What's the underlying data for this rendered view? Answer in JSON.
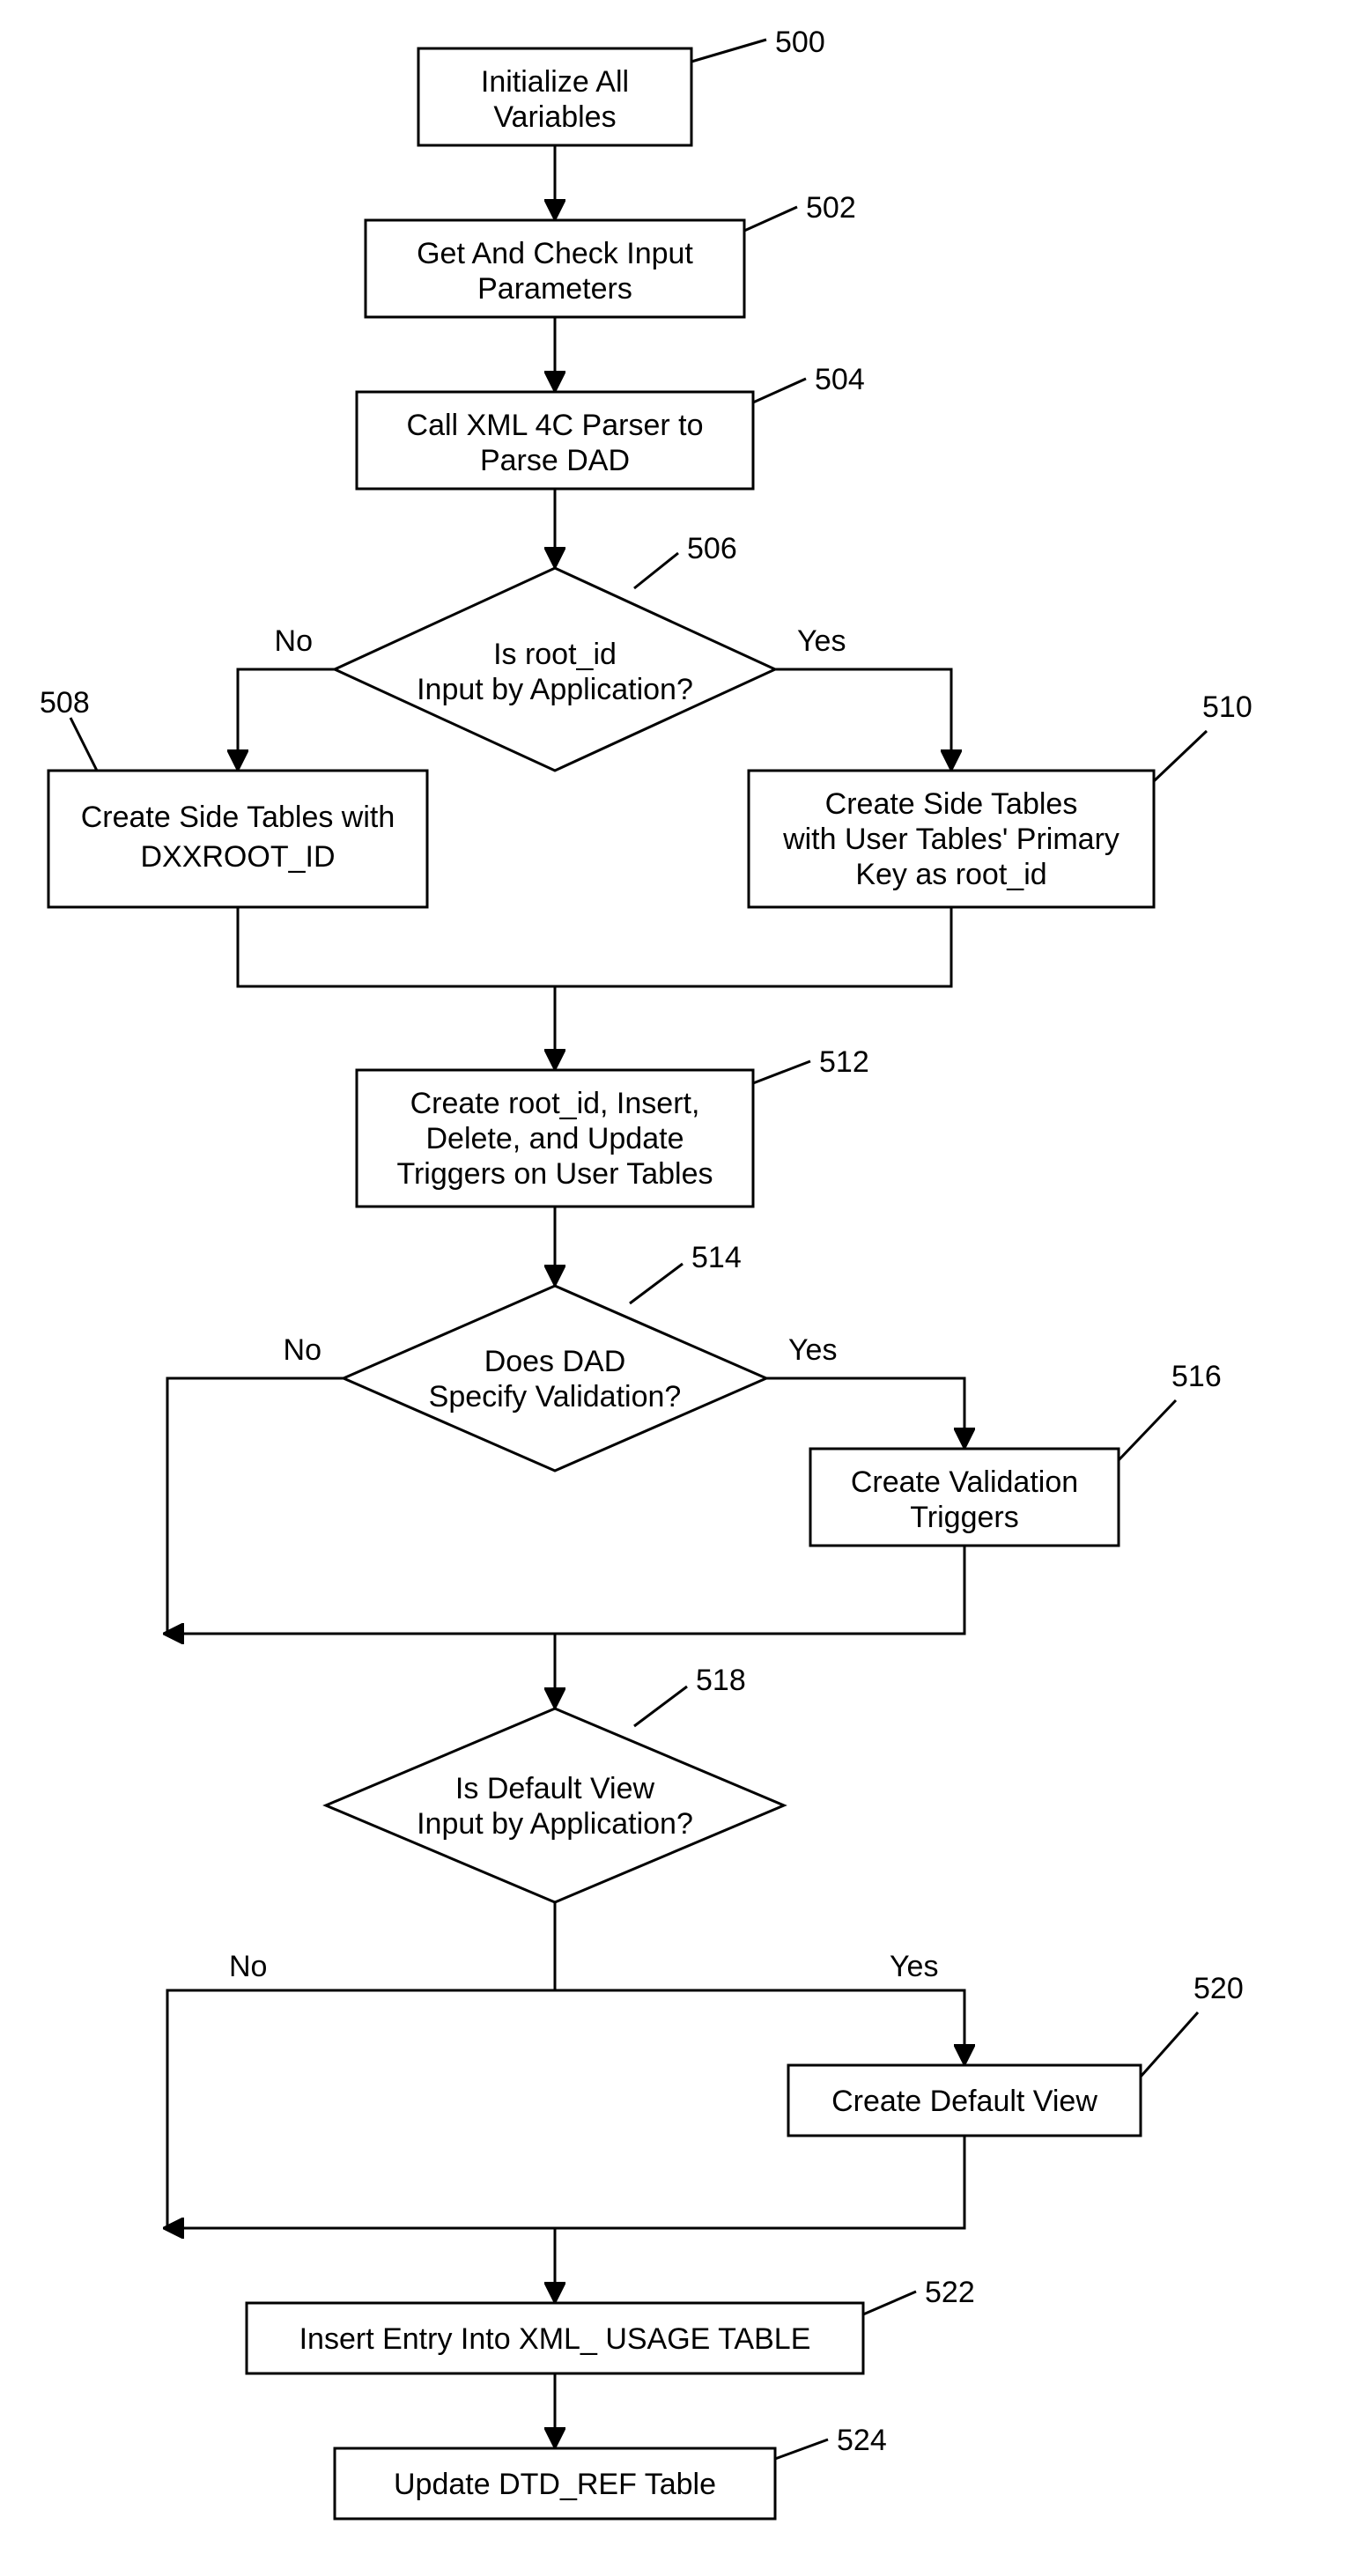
{
  "nodes": {
    "n500": {
      "ref": "500",
      "lines": [
        "Initialize All",
        "Variables"
      ]
    },
    "n502": {
      "ref": "502",
      "lines": [
        "Get And Check Input",
        "Parameters"
      ]
    },
    "n504": {
      "ref": "504",
      "lines": [
        "Call XML 4C Parser to",
        "Parse DAD"
      ]
    },
    "n506": {
      "ref": "506",
      "lines": [
        "Is root_id",
        "Input by Application?"
      ]
    },
    "n508": {
      "ref": "508",
      "lines": [
        "Create Side Tables with",
        "DXXROOT_ID"
      ]
    },
    "n510": {
      "ref": "510",
      "lines": [
        "Create Side Tables",
        "with User Tables' Primary",
        "Key as root_id"
      ]
    },
    "n512": {
      "ref": "512",
      "lines": [
        "Create root_id, Insert,",
        "Delete, and Update",
        "Triggers on User Tables"
      ]
    },
    "n514": {
      "ref": "514",
      "lines": [
        "Does DAD",
        "Specify Validation?"
      ]
    },
    "n516": {
      "ref": "516",
      "lines": [
        "Create Validation",
        "Triggers"
      ]
    },
    "n518": {
      "ref": "518",
      "lines": [
        "Is Default View",
        "Input by Application?"
      ]
    },
    "n520": {
      "ref": "520",
      "lines": [
        "Create Default View"
      ]
    },
    "n522": {
      "ref": "522",
      "lines": [
        "Insert Entry Into XML_ USAGE TABLE"
      ]
    },
    "n524": {
      "ref": "524",
      "lines": [
        "Update DTD_REF Table"
      ]
    }
  },
  "labels": {
    "no": "No",
    "yes": "Yes"
  },
  "chart_data": {
    "type": "flowchart",
    "nodes": [
      {
        "id": "500",
        "type": "process",
        "text": "Initialize All Variables"
      },
      {
        "id": "502",
        "type": "process",
        "text": "Get And Check Input Parameters"
      },
      {
        "id": "504",
        "type": "process",
        "text": "Call XML 4C Parser to Parse DAD"
      },
      {
        "id": "506",
        "type": "decision",
        "text": "Is root_id Input by Application?"
      },
      {
        "id": "508",
        "type": "process",
        "text": "Create Side Tables with DXXROOT_ID"
      },
      {
        "id": "510",
        "type": "process",
        "text": "Create Side Tables with User Tables' Primary Key as root_id"
      },
      {
        "id": "512",
        "type": "process",
        "text": "Create root_id, Insert, Delete, and Update Triggers on User Tables"
      },
      {
        "id": "514",
        "type": "decision",
        "text": "Does DAD Specify Validation?"
      },
      {
        "id": "516",
        "type": "process",
        "text": "Create Validation Triggers"
      },
      {
        "id": "518",
        "type": "decision",
        "text": "Is Default View Input by Application?"
      },
      {
        "id": "520",
        "type": "process",
        "text": "Create Default View"
      },
      {
        "id": "522",
        "type": "process",
        "text": "Insert Entry Into XML_ USAGE TABLE"
      },
      {
        "id": "524",
        "type": "process",
        "text": "Update DTD_REF Table"
      }
    ],
    "edges": [
      {
        "from": "500",
        "to": "502"
      },
      {
        "from": "502",
        "to": "504"
      },
      {
        "from": "504",
        "to": "506"
      },
      {
        "from": "506",
        "to": "508",
        "label": "No"
      },
      {
        "from": "506",
        "to": "510",
        "label": "Yes"
      },
      {
        "from": "508",
        "to": "512"
      },
      {
        "from": "510",
        "to": "512"
      },
      {
        "from": "512",
        "to": "514"
      },
      {
        "from": "514",
        "to": "516",
        "label": "Yes"
      },
      {
        "from": "514",
        "to": "518",
        "label": "No"
      },
      {
        "from": "516",
        "to": "518"
      },
      {
        "from": "518",
        "to": "520",
        "label": "Yes"
      },
      {
        "from": "518",
        "to": "522",
        "label": "No"
      },
      {
        "from": "520",
        "to": "522"
      },
      {
        "from": "522",
        "to": "524"
      }
    ]
  }
}
